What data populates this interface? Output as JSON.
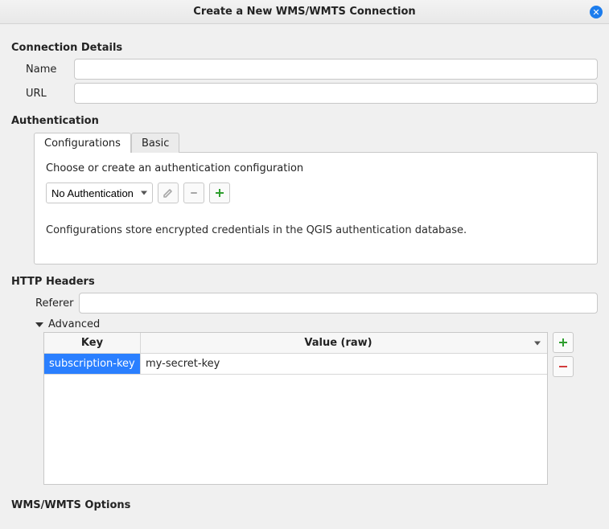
{
  "window": {
    "title": "Create a New WMS/WMTS Connection"
  },
  "sections": {
    "connection": "Connection Details",
    "auth": "Authentication",
    "http": "HTTP Headers",
    "options": "WMS/WMTS Options"
  },
  "connection": {
    "name_label": "Name",
    "name_value": "",
    "url_label": "URL",
    "url_value": ""
  },
  "auth": {
    "tabs": {
      "config": "Configurations",
      "basic": "Basic"
    },
    "prompt": "Choose or create an authentication configuration",
    "select_value": "No Authentication",
    "note": "Configurations store encrypted credentials in the QGIS authentication database."
  },
  "http": {
    "referer_label": "Referer",
    "referer_value": "",
    "advanced_label": "Advanced",
    "columns": {
      "key": "Key",
      "value": "Value (raw)"
    },
    "rows": [
      {
        "key": "subscription-key",
        "value": "my-secret-key"
      }
    ]
  }
}
